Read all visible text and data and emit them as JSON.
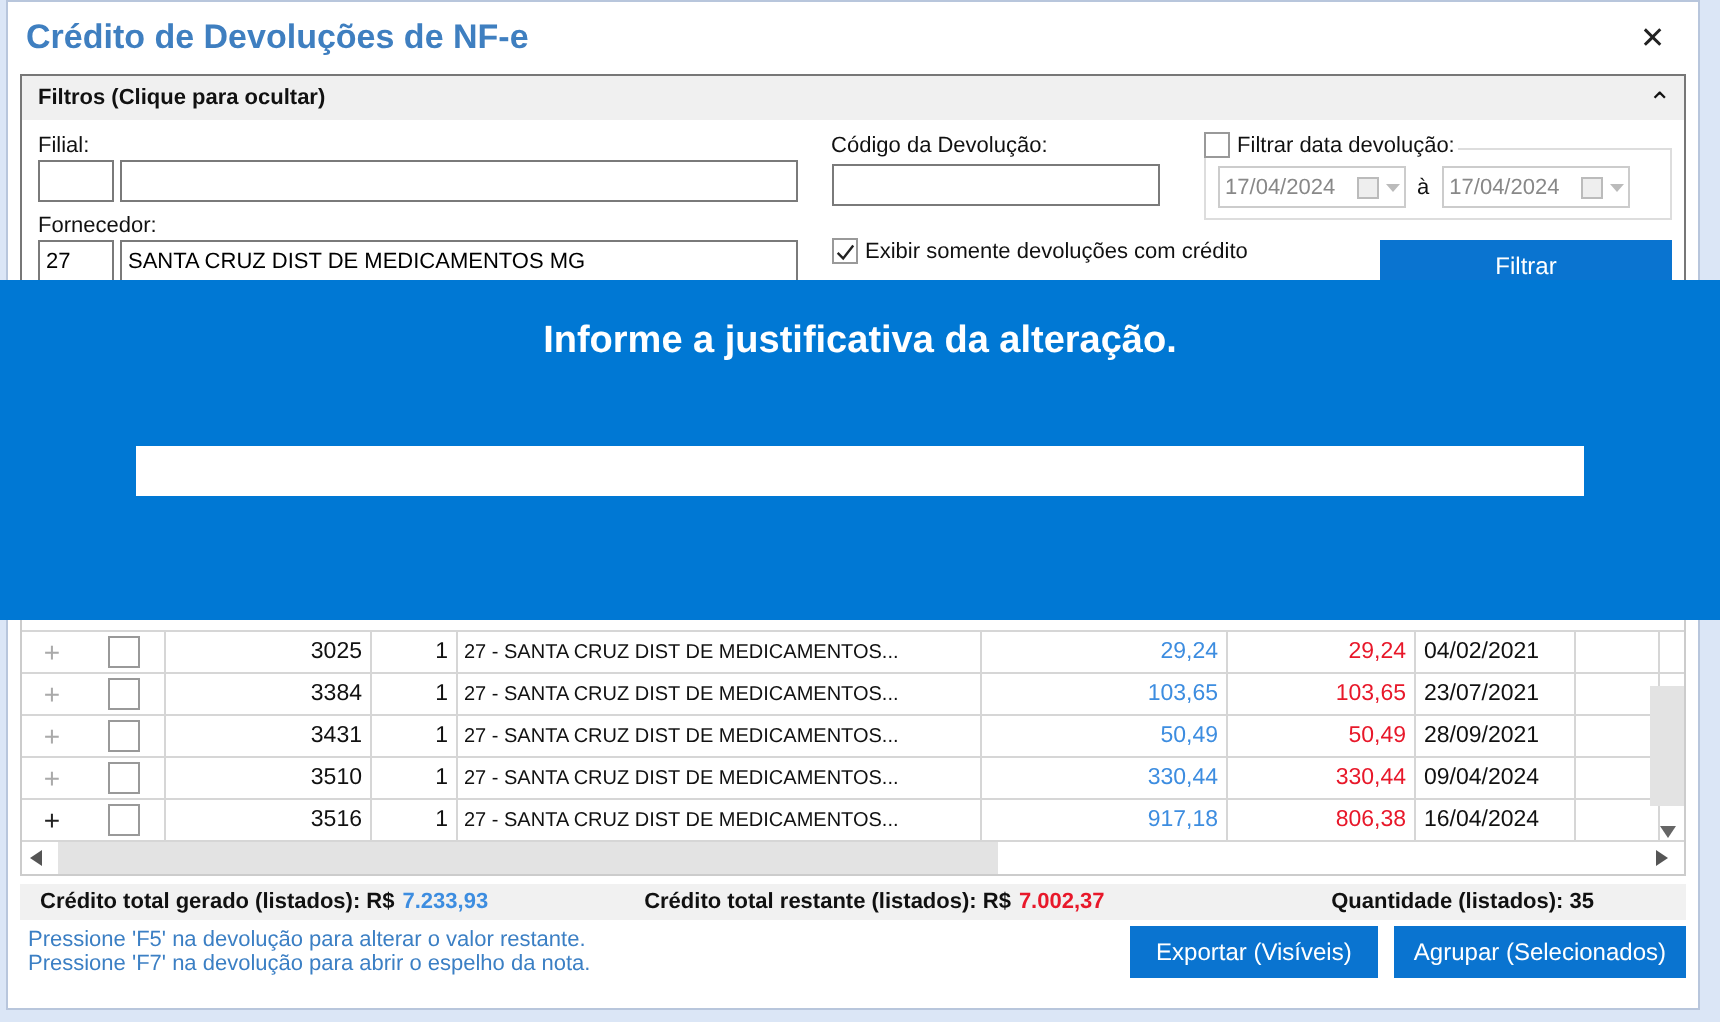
{
  "window": {
    "title": "Crédito de Devoluções de NF-e",
    "close": "✕"
  },
  "filters": {
    "header": "Filtros (Clique para ocultar)",
    "collapse": "⌃",
    "filial": {
      "label": "Filial:"
    },
    "codigo": {
      "label": "Código da Devolução:"
    },
    "date_filter": {
      "label": "Filtrar data devolução:",
      "checked": false,
      "disabled": true,
      "from": "17/04/2024",
      "sep": "à",
      "to": "17/04/2024"
    },
    "fornecedor": {
      "label": "Fornecedor:",
      "code": "27",
      "name": "SANTA CRUZ DIST DE MEDICAMENTOS MG"
    },
    "only_credit": {
      "label": "Exibir somente devoluções com crédito",
      "checked": true
    },
    "filter_button": "Filtrar"
  },
  "dialog": {
    "title": "Informe a justificativa da alteração."
  },
  "rows": [
    {
      "expander": "+",
      "selected": false,
      "checked": false,
      "number": "3025",
      "series": "1",
      "supplier": "27 - SANTA CRUZ DIST DE MEDICAMENTOS...",
      "credit": "29,24",
      "remaining": "29,24",
      "date": "04/02/2021"
    },
    {
      "expander": "+",
      "selected": false,
      "checked": false,
      "number": "3384",
      "series": "1",
      "supplier": "27 - SANTA CRUZ DIST DE MEDICAMENTOS...",
      "credit": "103,65",
      "remaining": "103,65",
      "date": "23/07/2021"
    },
    {
      "expander": "+",
      "selected": false,
      "checked": false,
      "number": "3431",
      "series": "1",
      "supplier": "27 - SANTA CRUZ DIST DE MEDICAMENTOS...",
      "credit": "50,49",
      "remaining": "50,49",
      "date": "28/09/2021"
    },
    {
      "expander": "+",
      "selected": false,
      "checked": false,
      "number": "3510",
      "series": "1",
      "supplier": "27 - SANTA CRUZ DIST DE MEDICAMENTOS...",
      "credit": "330,44",
      "remaining": "330,44",
      "date": "09/04/2024"
    },
    {
      "expander": "+",
      "selected": true,
      "checked": false,
      "number": "3516",
      "series": "1",
      "supplier": "27 - SANTA CRUZ DIST DE MEDICAMENTOS...",
      "credit": "917,18",
      "remaining": "806,38",
      "date": "16/04/2024"
    }
  ],
  "totals": {
    "generated_label": "Crédito total gerado (listados): R$",
    "generated": "7.233,93",
    "remaining_label": "Crédito total restante (listados): R$",
    "remaining": "7.002,37",
    "count": "Quantidade (listados): 35"
  },
  "hints": [
    "Pressione 'F5' na devolução para alterar o valor restante.",
    "Pressione 'F7' na devolução para abrir o espelho da nota."
  ],
  "buttons": [
    "Exportar (Visíveis)",
    "Agrupar (Selecionados)"
  ]
}
